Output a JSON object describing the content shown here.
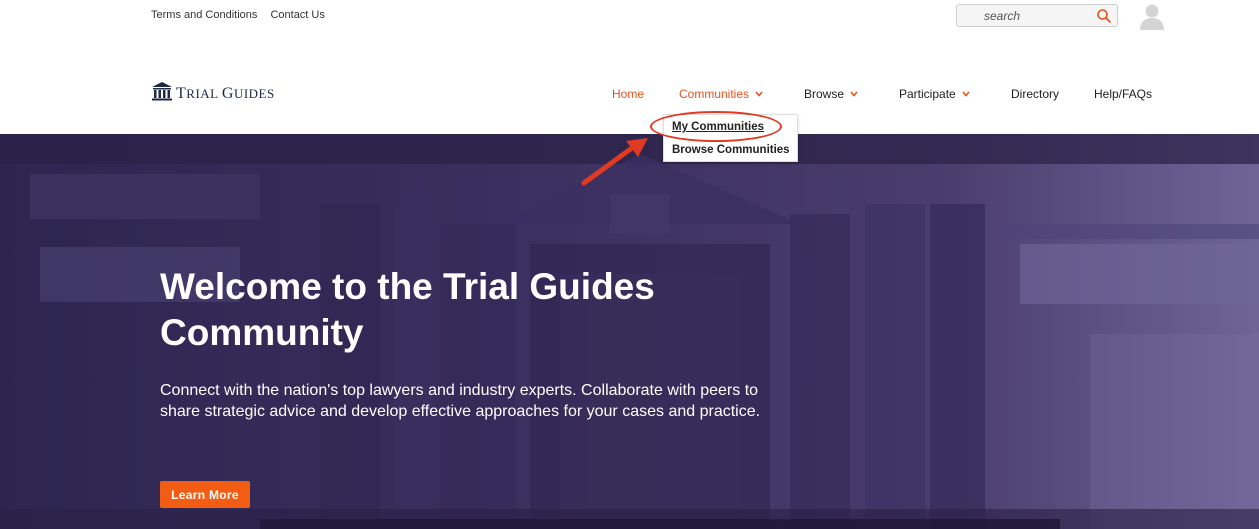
{
  "utility": {
    "links": [
      "Terms and Conditions",
      "Contact Us"
    ],
    "search_placeholder": "search",
    "search_icon": "search-icon",
    "avatar_icon": "user-avatar-icon"
  },
  "logo": {
    "text_big": "T",
    "text_rest": "RIAL ",
    "text_big2": "G",
    "text_rest2": "UIDES",
    "icon": "courthouse-columns-icon"
  },
  "nav": {
    "home": "Home",
    "communities": "Communities",
    "browse": "Browse",
    "participate": "Participate",
    "directory": "Directory",
    "help": "Help/FAQs"
  },
  "dropdown": {
    "items": [
      "My Communities",
      "Browse Communities"
    ]
  },
  "hero": {
    "title": "Welcome to the Trial Guides Community",
    "subtitle": "Connect with the nation's top lawyers and industry experts. Collaborate with peers to share strategic advice and develop effective approaches for your cases and practice.",
    "button_label": "Learn More"
  },
  "colors": {
    "accent": "#e8521b",
    "button": "#f25c13",
    "logo_navy": "#1e2a44",
    "annotation_red": "#e03a22"
  }
}
